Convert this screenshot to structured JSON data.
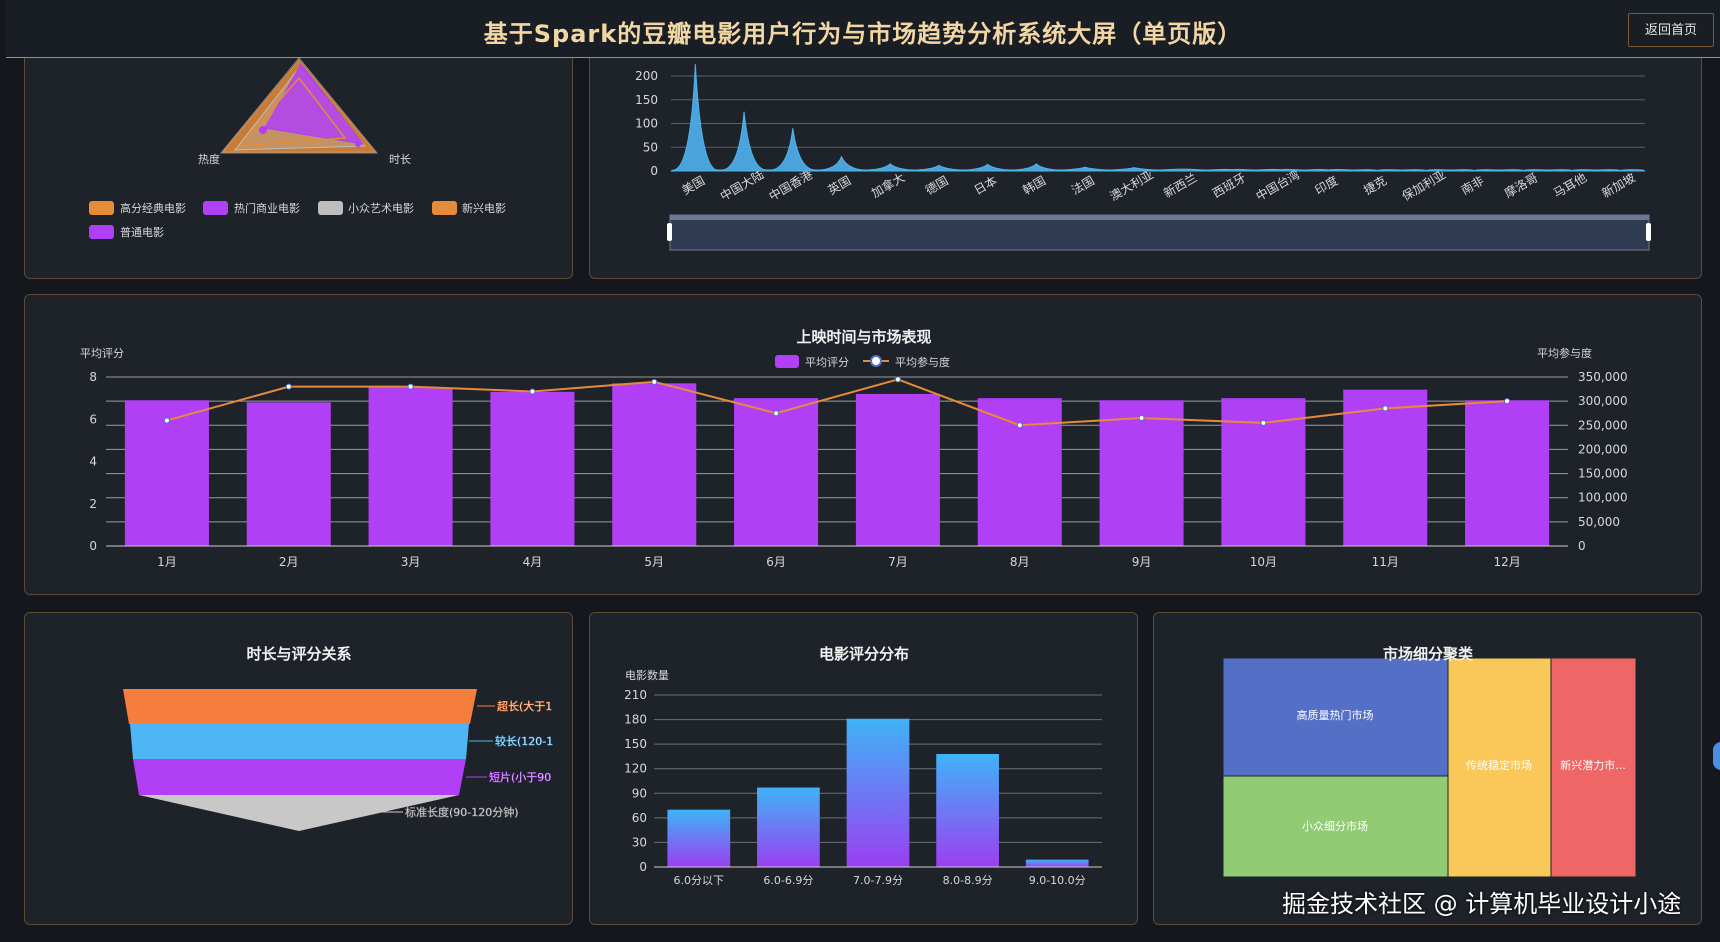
{
  "header": {
    "title": "基于Spark的豆瓣电影用户行为与市场趋势分析系统大屏（单页版）",
    "back_label": "返回首页"
  },
  "radar": {
    "labels": [
      "热度",
      "时长"
    ],
    "legend": [
      {
        "name": "高分经典电影",
        "color": "#e58b39"
      },
      {
        "name": "热门商业电影",
        "color": "#b13ff5"
      },
      {
        "name": "小众艺术电影",
        "color": "#bdbdbd"
      },
      {
        "name": "新兴电影",
        "color": "#e58b39"
      },
      {
        "name": "普通电影",
        "color": "#b13ff5"
      }
    ]
  },
  "region_chart": {
    "chart_data": {
      "type": "area",
      "categories": [
        "美国",
        "中国大陆",
        "中国香港",
        "英国",
        "加拿大",
        "德国",
        "日本",
        "韩国",
        "法国",
        "澳大利亚",
        "新西兰",
        "西班牙",
        "中国台湾",
        "印度",
        "捷克",
        "保加利亚",
        "南非",
        "摩洛哥",
        "马耳他",
        "新加坡"
      ],
      "values": [
        225,
        125,
        90,
        30,
        15,
        12,
        14,
        15,
        8,
        7,
        4,
        3,
        3,
        2,
        1,
        1,
        1,
        1,
        1,
        1
      ],
      "yticks": [
        "0",
        "50",
        "100",
        "150",
        "200"
      ],
      "ylim": [
        0,
        200
      ],
      "color": "#4fb3ee"
    }
  },
  "monthly_chart": {
    "title": "上映时间与市场表现",
    "legend_bar": "平均评分",
    "legend_line": "平均参与度",
    "chart_data": {
      "type": "bar",
      "title": "上映时间与市场表现",
      "categories": [
        "1月",
        "2月",
        "3月",
        "4月",
        "5月",
        "6月",
        "7月",
        "8月",
        "9月",
        "10月",
        "11月",
        "12月"
      ],
      "ylabel": "平均评分",
      "y2label": "平均参与度",
      "yticks": [
        "0",
        "2",
        "4",
        "6",
        "8"
      ],
      "y2ticks": [
        "0",
        "50,000",
        "100,000",
        "150,000",
        "200,000",
        "250,000",
        "300,000",
        "350,000"
      ],
      "ylim": [
        0,
        8
      ],
      "y2lim": [
        0,
        350000
      ],
      "series": [
        {
          "name": "平均评分",
          "type": "bar",
          "color": "#b13ff5",
          "values": [
            6.9,
            6.8,
            7.5,
            7.3,
            7.7,
            7.0,
            7.2,
            7.0,
            6.9,
            7.0,
            7.4,
            6.9
          ]
        },
        {
          "name": "平均参与度",
          "type": "line",
          "color": "#e58b39",
          "values": [
            260000,
            330000,
            330000,
            320000,
            340000,
            275000,
            345000,
            250000,
            265000,
            255000,
            285000,
            300000
          ]
        }
      ]
    }
  },
  "funnel": {
    "title": "时长与评分关系",
    "chart_data": {
      "type": "funnel",
      "categories": [
        "超长(大于1",
        "较长(120-1",
        "短片(小于90",
        "标准长度(90-120分钟)"
      ],
      "colors": [
        "#f57e3d",
        "#4fb6f5",
        "#b13ff5",
        "#c8c8c8"
      ]
    }
  },
  "rating_dist": {
    "title": "电影评分分布",
    "chart_data": {
      "type": "bar",
      "title": "电影评分分布",
      "ylabel": "电影数量",
      "categories": [
        "6.0分以下",
        "6.0-6.9分",
        "7.0-7.9分",
        "8.0-8.9分",
        "9.0-10.0分"
      ],
      "values": [
        70,
        97,
        181,
        138,
        9
      ],
      "yticks": [
        "0",
        "30",
        "60",
        "90",
        "120",
        "150",
        "180",
        "210"
      ],
      "ylim": [
        0,
        210
      ]
    }
  },
  "treemap": {
    "title": "市场细分聚类",
    "chart_data": {
      "type": "treemap",
      "items": [
        {
          "name": "高质量热门市场",
          "color": "#5470c6"
        },
        {
          "name": "小众细分市场",
          "color": "#91cc75"
        },
        {
          "name": "传统稳定市场",
          "color": "#fac858"
        },
        {
          "name": "新兴潜力市...",
          "color": "#ee6666"
        }
      ]
    }
  },
  "watermark": "掘金技术社区 @ 计算机毕业设计小途"
}
